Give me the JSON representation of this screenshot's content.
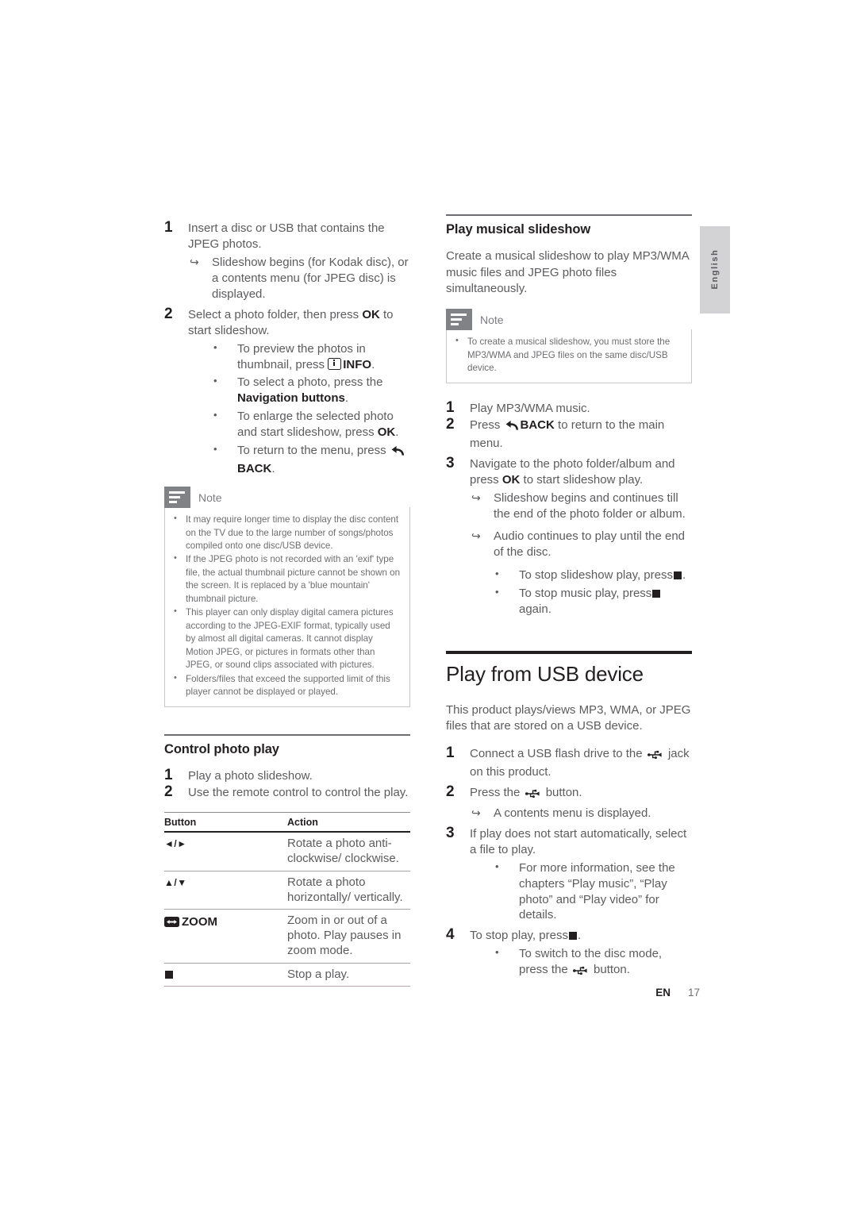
{
  "page": {
    "language_tab": "English",
    "footer_locale": "EN",
    "footer_page": "17"
  },
  "left_column": {
    "photo_steps": [
      {
        "num": "1",
        "text": "Insert a disc or USB that contains the JPEG photos.",
        "arrows": [
          "Slideshow begins (for Kodak disc), or a contents menu (for JPEG disc) is displayed."
        ]
      },
      {
        "num": "2",
        "text_before": "Select a photo folder, then press ",
        "bold1": "OK",
        "text_after": " to start slideshow.",
        "bullets": [
          {
            "pre": "To preview the photos in thumbnail, press ",
            "icon": "info-icon",
            "bold": "INFO",
            "post": "."
          },
          {
            "pre": "To select a photo, press the ",
            "bold": "Navigation buttons",
            "post": "."
          },
          {
            "pre": "To enlarge the selected photo and start slideshow, press ",
            "bold": "OK",
            "post": "."
          },
          {
            "pre": "To return to the menu, press ",
            "icon": "back-icon",
            "bold": "BACK",
            "post": "."
          }
        ]
      }
    ],
    "note": {
      "title": "Note",
      "items": [
        "It may require longer time to display the disc content on the TV due to the large number of songs/photos compiled onto one disc/USB device.",
        "If the JPEG photo is not recorded with an 'exif' type file, the actual thumbnail picture cannot be shown on the screen. It is replaced by a 'blue mountain' thumbnail picture.",
        "This player can only display digital camera pictures according to the JPEG-EXIF format, typically used by almost all digital cameras. It cannot display Motion JPEG, or pictures in formats other than JPEG, or sound clips associated with pictures.",
        "Folders/files that exceed the supported limit of this player cannot be displayed or played."
      ]
    },
    "control_section": {
      "heading": "Control photo play",
      "steps": [
        {
          "num": "1",
          "text": "Play a photo slideshow."
        },
        {
          "num": "2",
          "text": "Use the remote control to control the play."
        }
      ],
      "table": {
        "headers": [
          "Button",
          "Action"
        ],
        "rows": [
          {
            "button": "◄/►",
            "button_icon": "",
            "action": "Rotate a photo anti-clockwise/ clockwise."
          },
          {
            "button": "▲/▼",
            "button_icon": "",
            "action": "Rotate a photo horizontally/ vertically."
          },
          {
            "button": "ZOOM",
            "button_icon": "zoom-icon",
            "action": "Zoom in or out of a photo. Play pauses in zoom mode."
          },
          {
            "button": "",
            "button_icon": "stop-icon",
            "action": "Stop a play."
          }
        ]
      }
    }
  },
  "right_column": {
    "musical_section": {
      "heading": "Play musical slideshow",
      "intro": "Create a musical slideshow to play MP3/WMA music files and JPEG photo files simultaneously.",
      "note": {
        "title": "Note",
        "items": [
          "To create a musical slideshow, you must store the MP3/WMA and JPEG files on the same disc/USB device."
        ]
      },
      "steps": [
        {
          "num": "1",
          "text": "Play MP3/WMA music."
        },
        {
          "num": "2",
          "pre": "Press ",
          "icon": "back-icon",
          "bold": "BACK",
          "post": " to return to the main menu."
        },
        {
          "num": "3",
          "pre": "Navigate to the photo folder/album and press ",
          "bold": "OK",
          "post": " to start slideshow play.",
          "arrows": [
            "Slideshow begins and continues till the end of the photo folder or album.",
            "Audio continues to play until the end of the disc."
          ],
          "bullets": [
            {
              "pre": "To stop slideshow play, press",
              "icon": "stop-icon",
              "post": "."
            },
            {
              "pre": "To stop music play, press",
              "icon": "stop-icon",
              "post": "again."
            }
          ]
        }
      ]
    },
    "usb_section": {
      "heading": "Play from USB device",
      "intro": "This product plays/views MP3, WMA, or JPEG files that are stored on a USB device.",
      "steps": [
        {
          "num": "1",
          "pre": "Connect a USB flash drive to the ",
          "icon": "usb-icon",
          "post": " jack on this product."
        },
        {
          "num": "2",
          "pre": "Press the ",
          "icon": "usb-icon",
          "post": " button.",
          "arrows": [
            "A contents menu is displayed."
          ]
        },
        {
          "num": "3",
          "text": "If play does not start automatically, select a file to play.",
          "bullets": [
            {
              "pre": "For more information, see the chapters “Play music”, “Play photo” and “Play video” for details."
            }
          ]
        },
        {
          "num": "4",
          "pre": "To stop play, press",
          "icon": "stop-icon",
          "post": ".",
          "bullets": [
            {
              "pre": "To switch to the disc mode, press the ",
              "icon": "usb-icon",
              "post": " button."
            }
          ]
        }
      ]
    }
  },
  "colors": {
    "body_text": "#5c5c5f",
    "heading": "#231f20",
    "note_icon_bg": "#808285",
    "tab_bg": "#d3d3d6"
  }
}
